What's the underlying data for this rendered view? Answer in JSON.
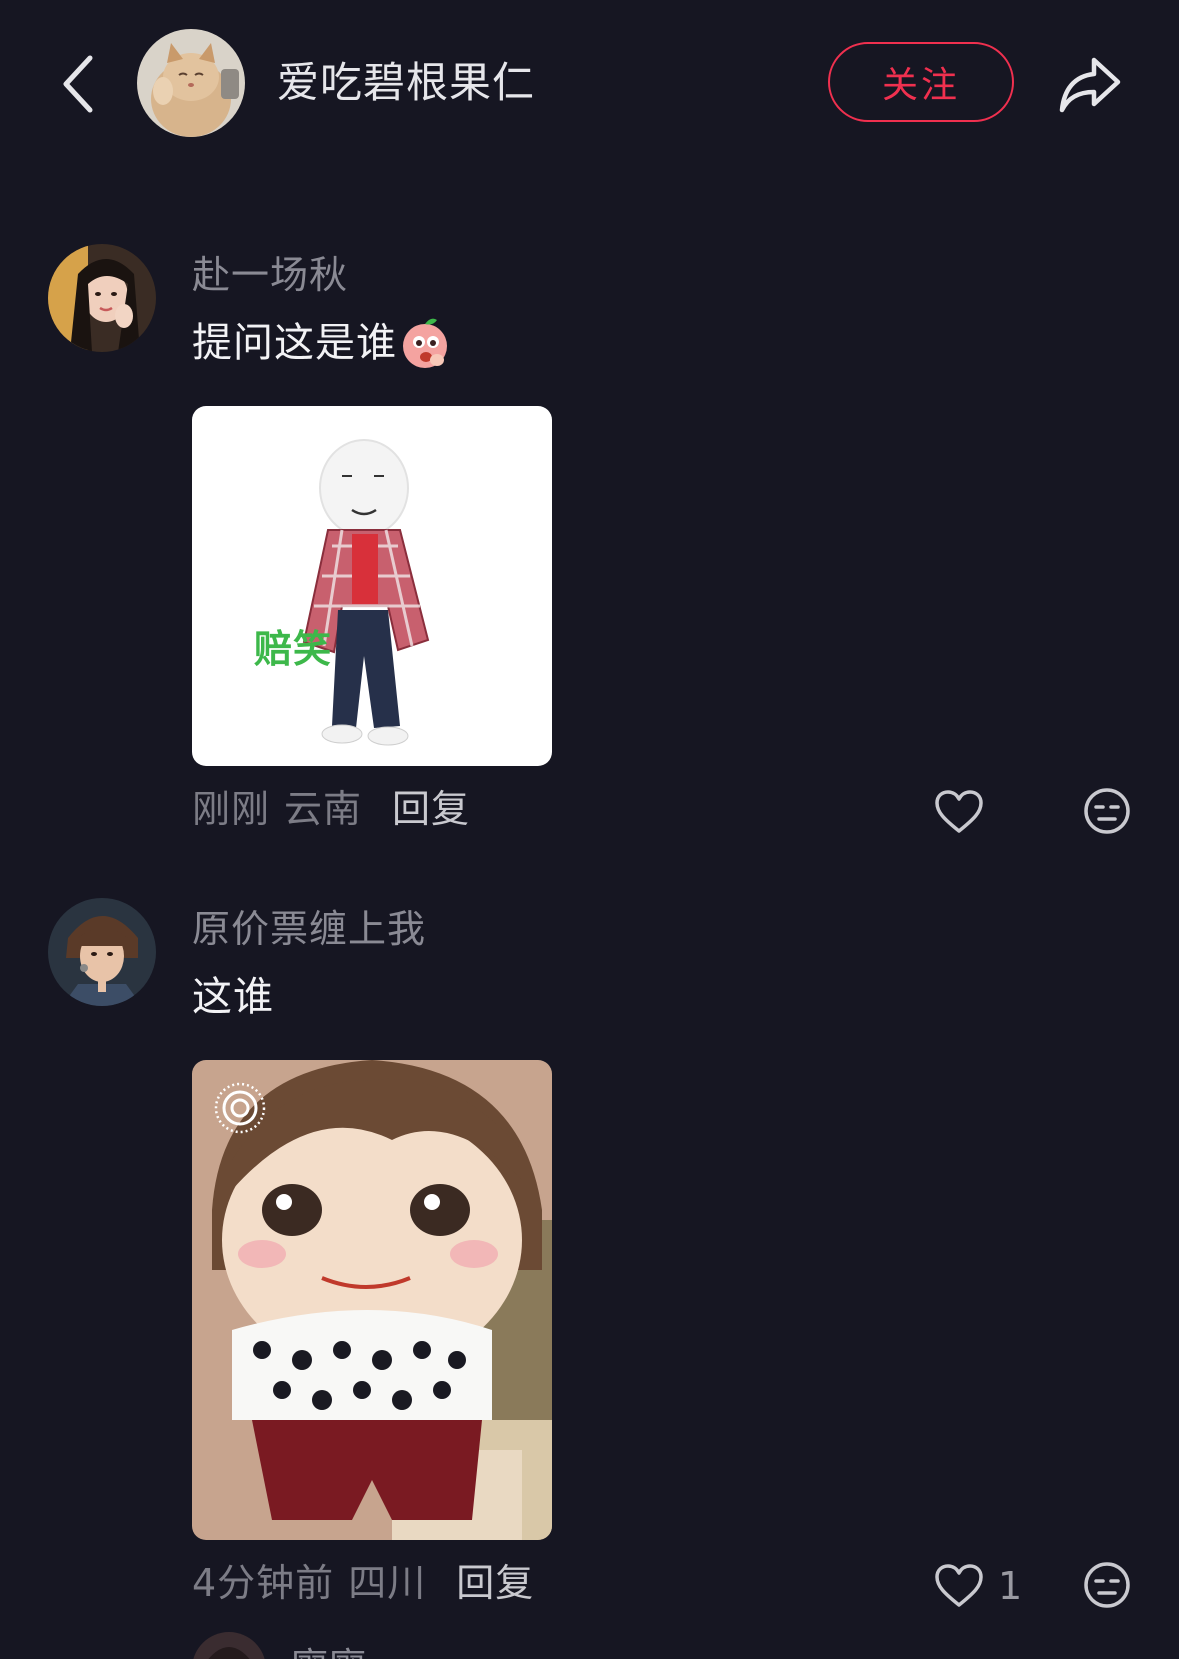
{
  "header": {
    "author_name": "爱吃碧根果仁",
    "follow_label": "关注"
  },
  "comments": [
    {
      "user": "赴一场秋",
      "text": "提问这是谁",
      "sticker_text": "赔笑",
      "time": "刚刚",
      "location": "云南",
      "reply_label": "回复",
      "likes": ""
    },
    {
      "user": "原价票缠上我",
      "text": "这谁",
      "time": "4分钟前",
      "location": "四川",
      "reply_label": "回复",
      "likes": "1"
    }
  ],
  "next_comment": {
    "user": "廖廖"
  },
  "colors": {
    "background": "#161622",
    "accent": "#f0304f",
    "sticker_green": "#3db84a"
  }
}
